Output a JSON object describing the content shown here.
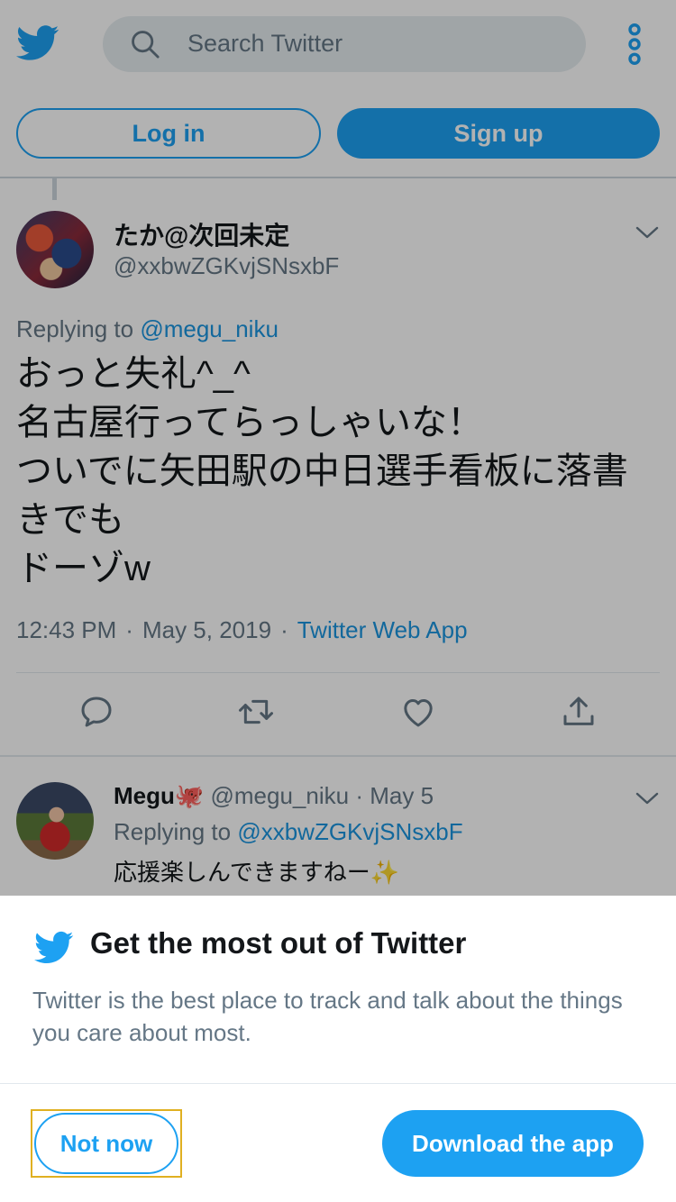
{
  "header": {
    "logo_icon": "twitter-bird-icon",
    "search_placeholder": "Search Twitter",
    "more_icon": "more-vertical-icon",
    "login_label": "Log in",
    "signup_label": "Sign up"
  },
  "tweet": {
    "display_name": "たか@次回未定",
    "handle": "@xxbwZGKvjSNsxbF",
    "replying_prefix": "Replying to",
    "replying_to": "@megu_niku",
    "text": "おっと失礼^_^\n名古屋行ってらっしゃいな！\nついでに矢田駅の中日選手看板に落書きでも\nドーゾw",
    "time": "12:43 PM",
    "date": "May 5, 2019",
    "source": "Twitter Web App",
    "actions": [
      "reply-icon",
      "retweet-icon",
      "like-icon",
      "share-icon"
    ]
  },
  "reply": {
    "display_name": "Megu🐙",
    "handle": "@megu_niku",
    "separator": "·",
    "date": "May 5",
    "replying_prefix": "Replying to",
    "replying_to": "@xxbwZGKvjSNsxbF",
    "text": "応援楽しんできますねー✨"
  },
  "sheet": {
    "title": "Get the most out of Twitter",
    "body": "Twitter is the best place to track and talk about the things you care about most.",
    "not_now_label": "Not now",
    "download_label": "Download the app"
  },
  "colors": {
    "brand": "#1da1f2",
    "link": "#1b95e0",
    "secondary_text": "#657786"
  }
}
